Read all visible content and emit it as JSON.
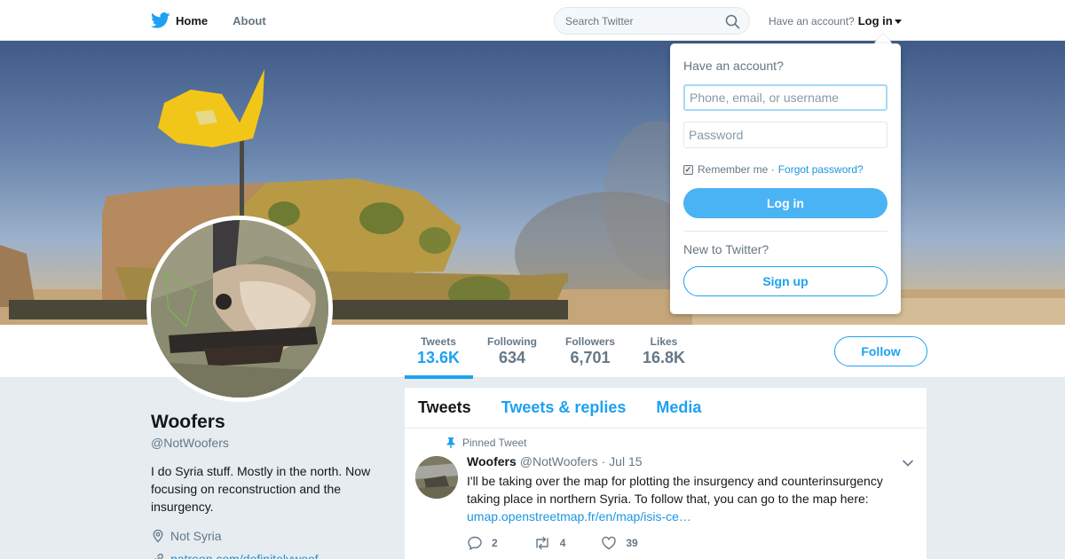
{
  "nav": {
    "home_label": "Home",
    "about_label": "About",
    "search_placeholder": "Search Twitter",
    "have_account": "Have an account?",
    "login_label": "Log in"
  },
  "colors": {
    "accent": "#1da1f2",
    "link": "#1b95e0",
    "button_fill": "#4ab3f4",
    "flag": "#f2c618"
  },
  "icons": [
    "twitter-bird-icon",
    "search-icon",
    "chevron-down-icon",
    "pin-icon",
    "reply-icon",
    "retweet-icon",
    "like-icon",
    "location-icon",
    "link-icon"
  ],
  "profile": {
    "name": "Woofers",
    "handle": "@NotWoofers",
    "bio": "I do Syria stuff. Mostly in the north. Now focusing on reconstruction and the insurgency.",
    "location": "Not Syria",
    "website": "patreon.com/definitelywoof",
    "follow_label": "Follow"
  },
  "stats": [
    {
      "label": "Tweets",
      "value": "13.6K"
    },
    {
      "label": "Following",
      "value": "634"
    },
    {
      "label": "Followers",
      "value": "6,701"
    },
    {
      "label": "Likes",
      "value": "16.8K"
    }
  ],
  "tabs": [
    "Tweets",
    "Tweets & replies",
    "Media"
  ],
  "pinned_tweet": {
    "pinned_label": "Pinned Tweet",
    "author_name": "Woofers",
    "author_handle": "@NotWoofers",
    "date": "· Jul 15",
    "text": "I'll be taking over the map for plotting the insurgency and counterinsurgency taking place in northern Syria. To follow that, you can go to the map here:",
    "link": "umap.openstreetmap.fr/en/map/isis-ce…",
    "replies": "2",
    "retweets": "4",
    "likes": "39"
  },
  "login_dropdown": {
    "title": "Have an account?",
    "username_placeholder": "Phone, email, or username",
    "password_placeholder": "Password",
    "remember_label": "Remember me ·",
    "forgot_label": "Forgot password?",
    "login_button": "Log in",
    "new_prompt": "New to Twitter?",
    "signup_button": "Sign up"
  }
}
